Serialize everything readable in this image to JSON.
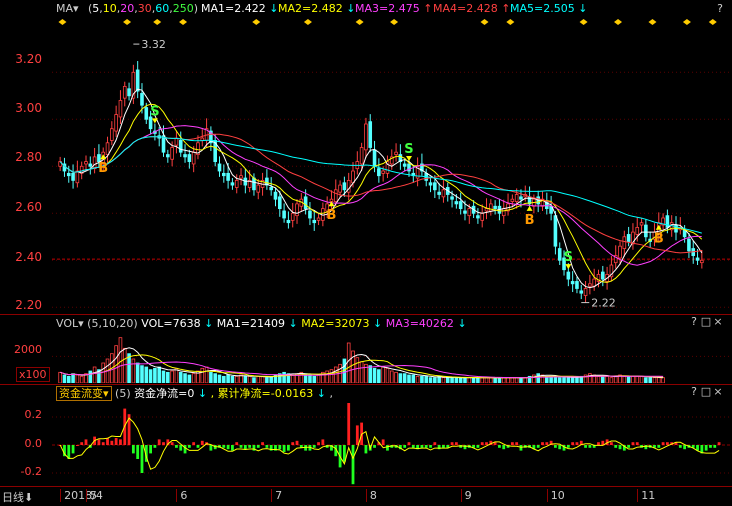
{
  "price_panel": {
    "indicator": "MA",
    "params_open": "(",
    "params": [
      "5",
      "10",
      "20",
      "30",
      "60",
      "250"
    ],
    "params_close": ")",
    "ma_values": [
      {
        "label": "MA1=2.422",
        "arrow": "↓",
        "color": "#ffffff"
      },
      {
        "label": "MA2=2.482",
        "arrow": "↓",
        "color": "#ffff00"
      },
      {
        "label": "MA3=2.475",
        "arrow": "↑",
        "color": "#ff40ff"
      },
      {
        "label": "MA4=2.428",
        "arrow": "↑",
        "color": "#ff4040"
      },
      {
        "label": "MA5=2.505",
        "arrow": "↓",
        "color": "#00ffff"
      }
    ],
    "y_ticks": [
      "3.20",
      "3.00",
      "2.80",
      "2.60",
      "2.40",
      "2.20"
    ],
    "annotations": {
      "high": "3.32",
      "low": "2.22"
    },
    "signals": [
      {
        "t": "B",
        "i": 10,
        "side": "below"
      },
      {
        "t": "S",
        "i": 22,
        "side": "above"
      },
      {
        "t": "B",
        "i": 63,
        "side": "below"
      },
      {
        "t": "S",
        "i": 81,
        "side": "above"
      },
      {
        "t": "B",
        "i": 109,
        "side": "below"
      },
      {
        "t": "S",
        "i": 118,
        "side": "above"
      },
      {
        "t": "B",
        "i": 139,
        "side": "below"
      },
      {
        "t": "S",
        "i": 155,
        "side": "above"
      }
    ]
  },
  "vol_panel": {
    "title": "VOL",
    "params": "(5,10,20)",
    "vol": "VOL=7638",
    "vol_arrow": "↓",
    "ma1": "MA1=21409",
    "ma1_arrow": "↓",
    "ma2": "MA2=32073",
    "ma2_arrow": "↓",
    "ma3": "MA3=40262",
    "ma3_arrow": "↓",
    "y_tick": "2000",
    "unit": "x100"
  },
  "flow_panel": {
    "title": "资金流变",
    "params": "(5)",
    "net": "资金净流=0",
    "net_arrow": "↓",
    "cum": "累计净流=-0.0163",
    "cum_arrow": "↓",
    "dot": ",",
    "y_ticks": [
      "0.2",
      "0.0",
      "-0.2"
    ]
  },
  "window_controls": {
    "help": "?",
    "min": "□",
    "max": "□",
    "close": "×"
  },
  "time_axis": {
    "period_label": "日线",
    "labels": [
      "2018/4",
      "5",
      "6",
      "7",
      "8",
      "9",
      "10",
      "11"
    ]
  },
  "chart_data": {
    "type": "candlestick",
    "y_range": [
      2.18,
      3.38
    ],
    "close": [
      2.82,
      2.78,
      2.76,
      2.74,
      2.78,
      2.8,
      2.82,
      2.8,
      2.84,
      2.82,
      2.86,
      2.9,
      2.96,
      3.02,
      3.08,
      3.14,
      3.1,
      3.2,
      3.12,
      3.06,
      3.0,
      2.96,
      2.94,
      2.92,
      2.86,
      2.84,
      2.88,
      2.92,
      2.86,
      2.84,
      2.82,
      2.86,
      2.9,
      2.92,
      2.96,
      2.9,
      2.82,
      2.78,
      2.76,
      2.74,
      2.72,
      2.74,
      2.76,
      2.72,
      2.74,
      2.7,
      2.72,
      2.74,
      2.72,
      2.7,
      2.66,
      2.62,
      2.58,
      2.56,
      2.6,
      2.64,
      2.66,
      2.62,
      2.58,
      2.56,
      2.58,
      2.62,
      2.64,
      2.66,
      2.7,
      2.72,
      2.7,
      2.74,
      2.78,
      2.82,
      2.88,
      2.98,
      2.88,
      2.8,
      2.76,
      2.78,
      2.82,
      2.84,
      2.86,
      2.82,
      2.8,
      2.78,
      2.76,
      2.8,
      2.78,
      2.74,
      2.72,
      2.7,
      2.68,
      2.7,
      2.68,
      2.66,
      2.64,
      2.62,
      2.6,
      2.62,
      2.6,
      2.58,
      2.6,
      2.62,
      2.64,
      2.62,
      2.6,
      2.62,
      2.64,
      2.66,
      2.68,
      2.66,
      2.68,
      2.64,
      2.66,
      2.64,
      2.66,
      2.62,
      2.6,
      2.46,
      2.4,
      2.36,
      2.32,
      2.3,
      2.28,
      2.26,
      2.28,
      2.3,
      2.32,
      2.34,
      2.32,
      2.34,
      2.38,
      2.42,
      2.46,
      2.5,
      2.48,
      2.52,
      2.54,
      2.56,
      2.5,
      2.48,
      2.52,
      2.56,
      2.58,
      2.54,
      2.56,
      2.52,
      2.54,
      2.5,
      2.44,
      2.42,
      2.4,
      2.4
    ],
    "volume": [
      800,
      600,
      500,
      700,
      600,
      500,
      700,
      900,
      1200,
      1000,
      1500,
      1800,
      2200,
      2800,
      3400,
      2600,
      2200,
      1800,
      1500,
      1300,
      1200,
      1000,
      1100,
      1200,
      900,
      800,
      900,
      1100,
      800,
      700,
      600,
      700,
      900,
      1100,
      1200,
      800,
      700,
      600,
      500,
      600,
      500,
      500,
      600,
      500,
      500,
      400,
      500,
      500,
      400,
      500,
      600,
      700,
      800,
      700,
      600,
      700,
      800,
      700,
      600,
      500,
      600,
      800,
      900,
      1000,
      1200,
      1400,
      1800,
      3000,
      2400,
      1900,
      1600,
      1400,
      1300,
      1100,
      1000,
      1200,
      1100,
      900,
      800,
      700,
      700,
      600,
      600,
      500,
      500,
      500,
      400,
      400,
      500,
      400,
      400,
      400,
      400,
      400,
      400,
      400,
      400,
      400,
      400,
      400,
      400,
      400,
      400,
      400,
      400,
      400,
      400,
      400,
      400,
      500,
      600,
      700,
      600,
      500,
      500,
      500,
      400,
      400,
      400,
      400,
      500,
      500,
      600,
      700,
      600,
      500,
      500,
      500,
      400,
      500,
      600,
      500,
      500,
      500,
      500,
      500,
      400,
      400,
      400,
      400,
      400
    ],
    "flow": [
      0,
      -0.08,
      -0.1,
      -0.06,
      0,
      0.02,
      0.04,
      -0.02,
      0.06,
      0.04,
      0.02,
      0.05,
      0.03,
      0.05,
      0.04,
      0.26,
      0.22,
      -0.06,
      -0.1,
      -0.2,
      -0.12,
      -0.06,
      -0.02,
      0.04,
      0.02,
      0.04,
      0.02,
      -0.02,
      -0.04,
      -0.06,
      -0.02,
      0.02,
      -0.02,
      0.03,
      0.02,
      -0.04,
      -0.03,
      -0.02,
      -0.02,
      -0.03,
      -0.04,
      0.02,
      -0.02,
      -0.03,
      -0.02,
      -0.04,
      -0.02,
      0.02,
      -0.02,
      -0.04,
      -0.04,
      -0.03,
      -0.05,
      -0.04,
      0.02,
      0.03,
      -0.02,
      -0.04,
      -0.04,
      -0.02,
      0.02,
      0.04,
      -0.02,
      -0.04,
      -0.08,
      -0.16,
      -0.12,
      0.34,
      -0.28,
      0.14,
      0.16,
      -0.06,
      -0.04,
      -0.02,
      0.02,
      0.04,
      -0.04,
      -0.02,
      -0.02,
      -0.03,
      -0.02,
      0.02,
      -0.02,
      -0.03,
      -0.02,
      -0.02,
      -0.02,
      0.02,
      -0.03,
      -0.02,
      -0.02,
      0.02,
      0.02,
      -0.02,
      -0.03,
      -0.02,
      -0.02,
      -0.02,
      0.02,
      0.02,
      0.03,
      0.02,
      -0.02,
      -0.03,
      -0.02,
      0.02,
      0.02,
      -0.04,
      -0.02,
      -0.02,
      -0.03,
      -0.02,
      0.02,
      0.02,
      0.03,
      -0.02,
      -0.03,
      -0.04,
      -0.02,
      0.02,
      0.02,
      0.03,
      -0.02,
      -0.02,
      -0.02,
      0.02,
      0.03,
      0.04,
      0.02,
      -0.02,
      -0.03,
      -0.04,
      -0.02,
      0.02,
      0.02,
      -0.02,
      -0.03,
      -0.02,
      -0.02,
      -0.02,
      0.02,
      0.02,
      0.02,
      0.02,
      -0.02,
      -0.03,
      -0.02,
      -0.02,
      -0.04,
      -0.06,
      -0.04,
      -0.02,
      -0.02,
      0.02
    ]
  }
}
